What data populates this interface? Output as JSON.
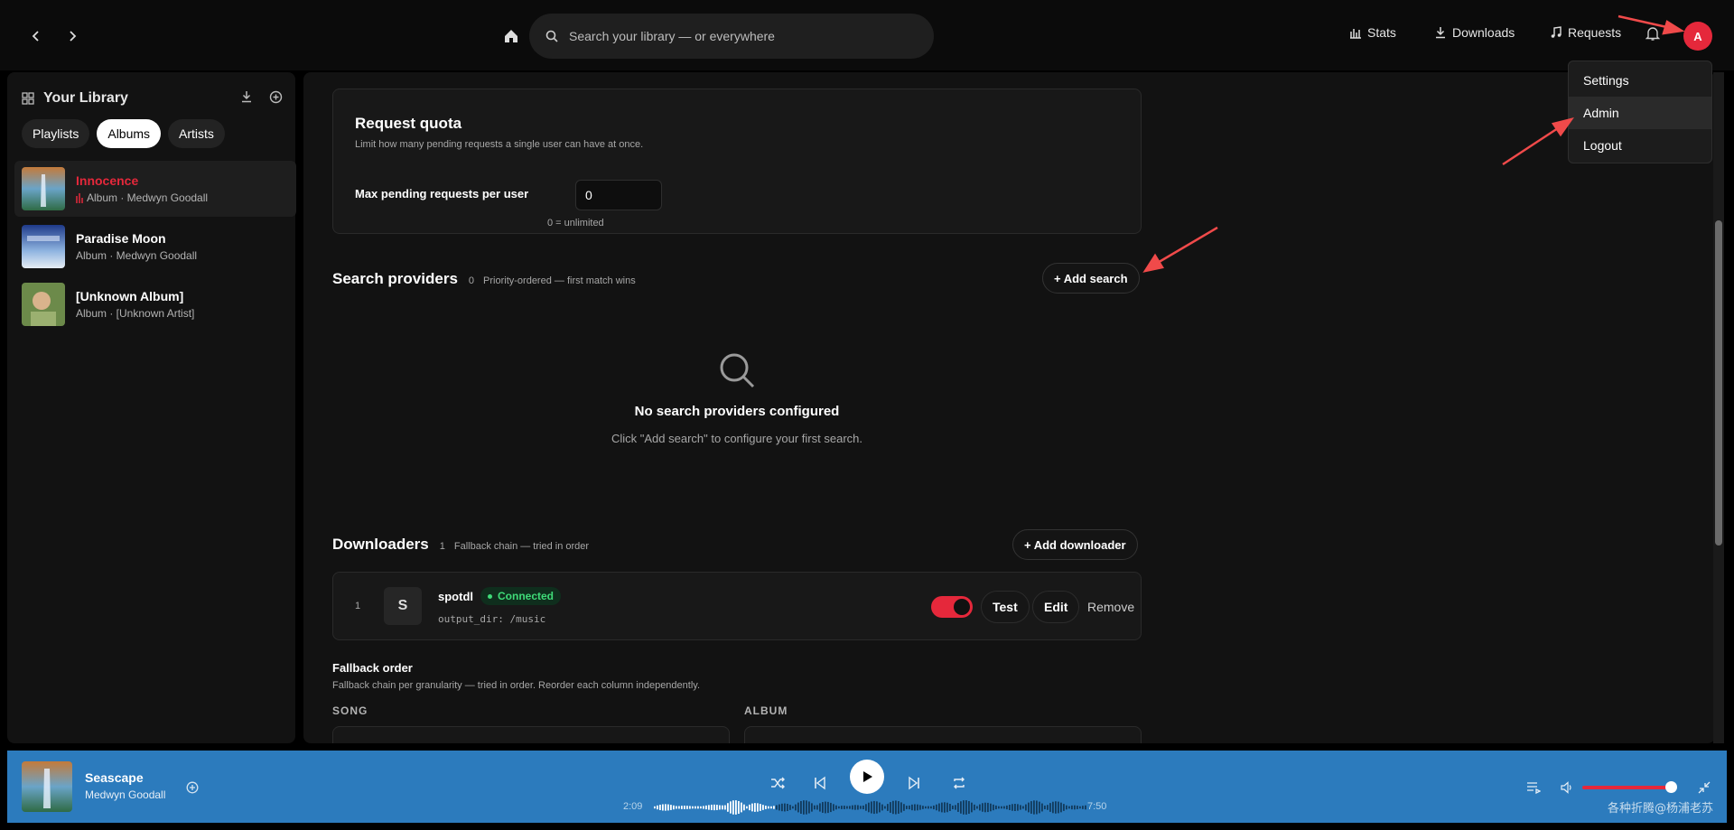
{
  "topbar": {
    "search_placeholder": "Search your library — or everywhere",
    "links": {
      "stats": "Stats",
      "downloads": "Downloads",
      "requests": "Requests"
    },
    "avatar_initial": "A"
  },
  "user_menu": {
    "items": [
      "Settings",
      "Admin",
      "Logout"
    ]
  },
  "sidebar": {
    "title": "Your Library",
    "filters": [
      "Playlists",
      "Albums",
      "Artists"
    ],
    "active_filter": "Albums",
    "items": [
      {
        "name": "Innocence",
        "sub": "Album · Medwyn Goodall",
        "playing": true
      },
      {
        "name": "Paradise Moon",
        "sub": "Album · Medwyn Goodall",
        "playing": false
      },
      {
        "name": "[Unknown Album]",
        "sub": "Album · [Unknown Artist]",
        "playing": false
      }
    ]
  },
  "quota": {
    "title": "Request quota",
    "description": "Limit how many pending requests a single user can have at once.",
    "field_label": "Max pending requests per user",
    "value": "0",
    "hint": "0 = unlimited"
  },
  "search_providers": {
    "title": "Search providers",
    "count": "0",
    "subtitle": "Priority-ordered — first match wins",
    "add_label": "+ Add search",
    "empty_title": "No search providers configured",
    "empty_text": "Click \"Add search\" to configure your first search."
  },
  "downloaders": {
    "title": "Downloaders",
    "count": "1",
    "subtitle": "Fallback chain — tried in order",
    "add_label": "+ Add downloader",
    "items": [
      {
        "index": "1",
        "initial": "S",
        "name": "spotdl",
        "status": "Connected",
        "config": "output_dir: /music",
        "enabled": true,
        "test_label": "Test",
        "edit_label": "Edit",
        "remove_label": "Remove"
      }
    ]
  },
  "fallback": {
    "title": "Fallback order",
    "description": "Fallback chain per granularity — tried in order. Reorder each column independently.",
    "columns": [
      "SONG",
      "ALBUM"
    ]
  },
  "player": {
    "title": "Seascape",
    "artist": "Medwyn Goodall",
    "elapsed": "2:09",
    "duration": "7:50",
    "progress": 0.275,
    "volume": 0.95
  },
  "watermark": "各种折腾@杨浦老苏",
  "colors": {
    "accent": "#e5283b",
    "player_bg": "#2c7bbd",
    "success": "#3fdb78"
  }
}
